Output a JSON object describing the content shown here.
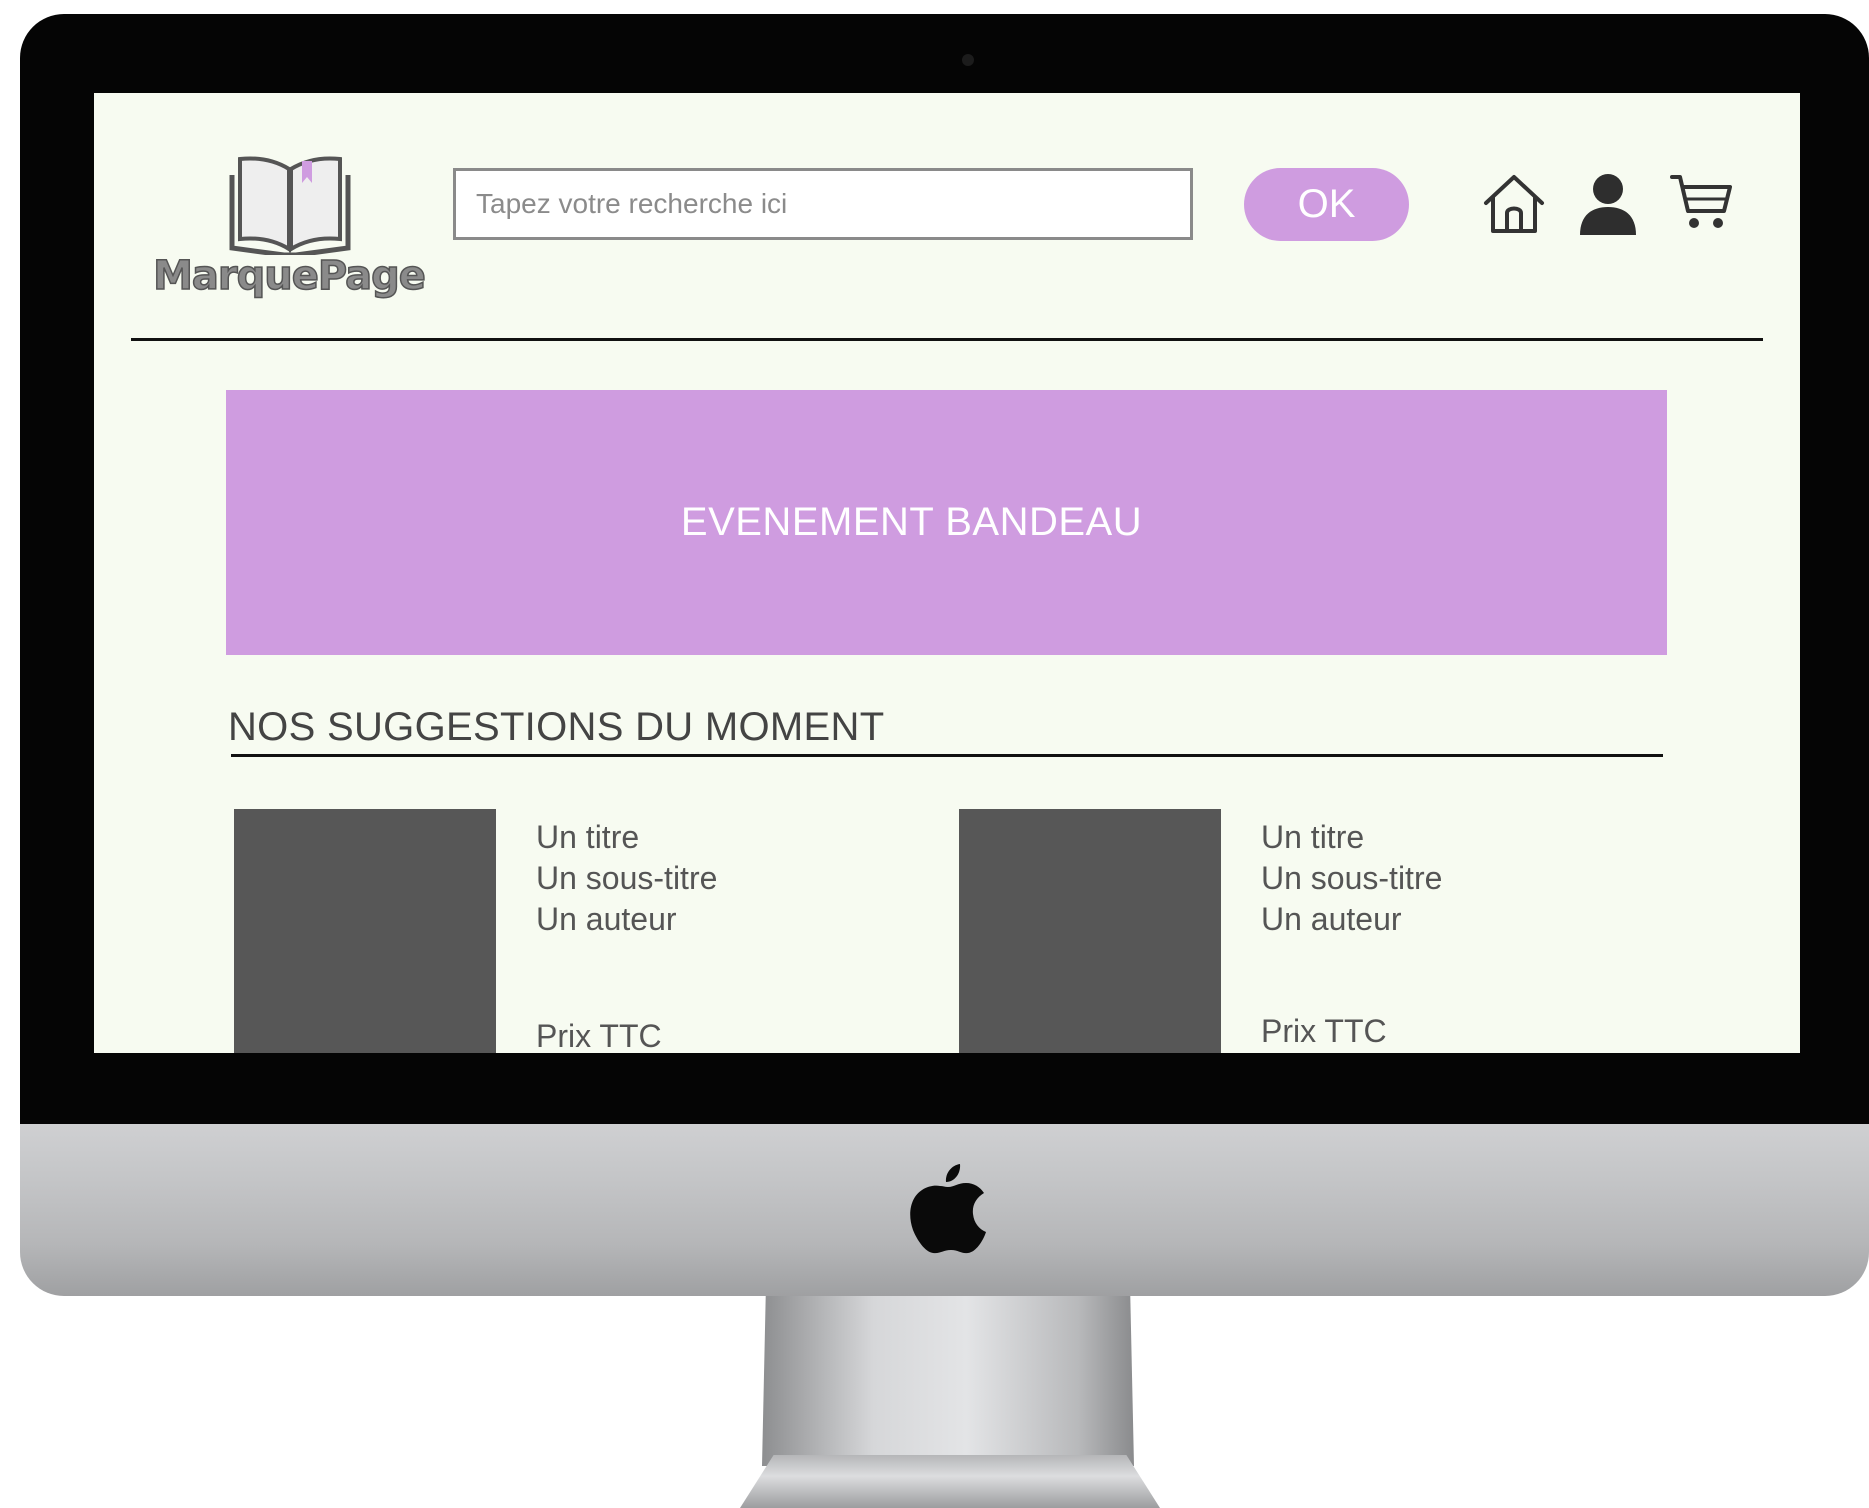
{
  "logo": {
    "text": "MarquePage"
  },
  "header": {
    "search": {
      "placeholder": "Tapez votre recherche ici",
      "value": ""
    },
    "ok_label": "OK",
    "icons": [
      "home-icon",
      "user-icon",
      "cart-icon"
    ]
  },
  "banner": {
    "text": "EVENEMENT BANDEAU"
  },
  "suggestions": {
    "title": "NOS SUGGESTIONS DU MOMENT",
    "items": [
      {
        "title": "Un titre",
        "subtitle": "Un sous-titre",
        "author": "Un auteur",
        "price": "Prix TTC"
      },
      {
        "title": "Un titre",
        "subtitle": "Un sous-titre",
        "author": "Un auteur",
        "price": "Prix TTC"
      }
    ]
  },
  "colors": {
    "accent": "#cf9ce0",
    "page_background": "#f7fbf1",
    "cover_placeholder": "#575757",
    "text": "#555555"
  }
}
